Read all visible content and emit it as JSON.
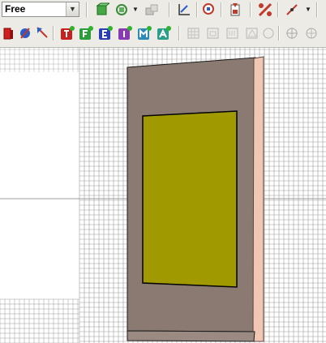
{
  "toolbar": {
    "view_mode": {
      "selected": "Free"
    },
    "row1_icons": [
      "bounding-box-icon",
      "work-plane-icon",
      "pick-icon",
      "local-coords-icon",
      "zoom-icon",
      "import-icon",
      "cut-object-icon",
      "curve-icon"
    ],
    "row2_icons": [
      "solid-icon",
      "pick-point-icon",
      "cursor-icon",
      "t-solver-icon",
      "f-solver-icon",
      "e-solver-icon",
      "i-solver-icon",
      "m-solver-icon",
      "a-solver-icon"
    ]
  },
  "colors": {
    "background": "#ffffff",
    "mesh": "#9c9c9c",
    "substrate": "#8a7a72",
    "patch": "#a09a00",
    "edge": "#f1c7b4"
  }
}
